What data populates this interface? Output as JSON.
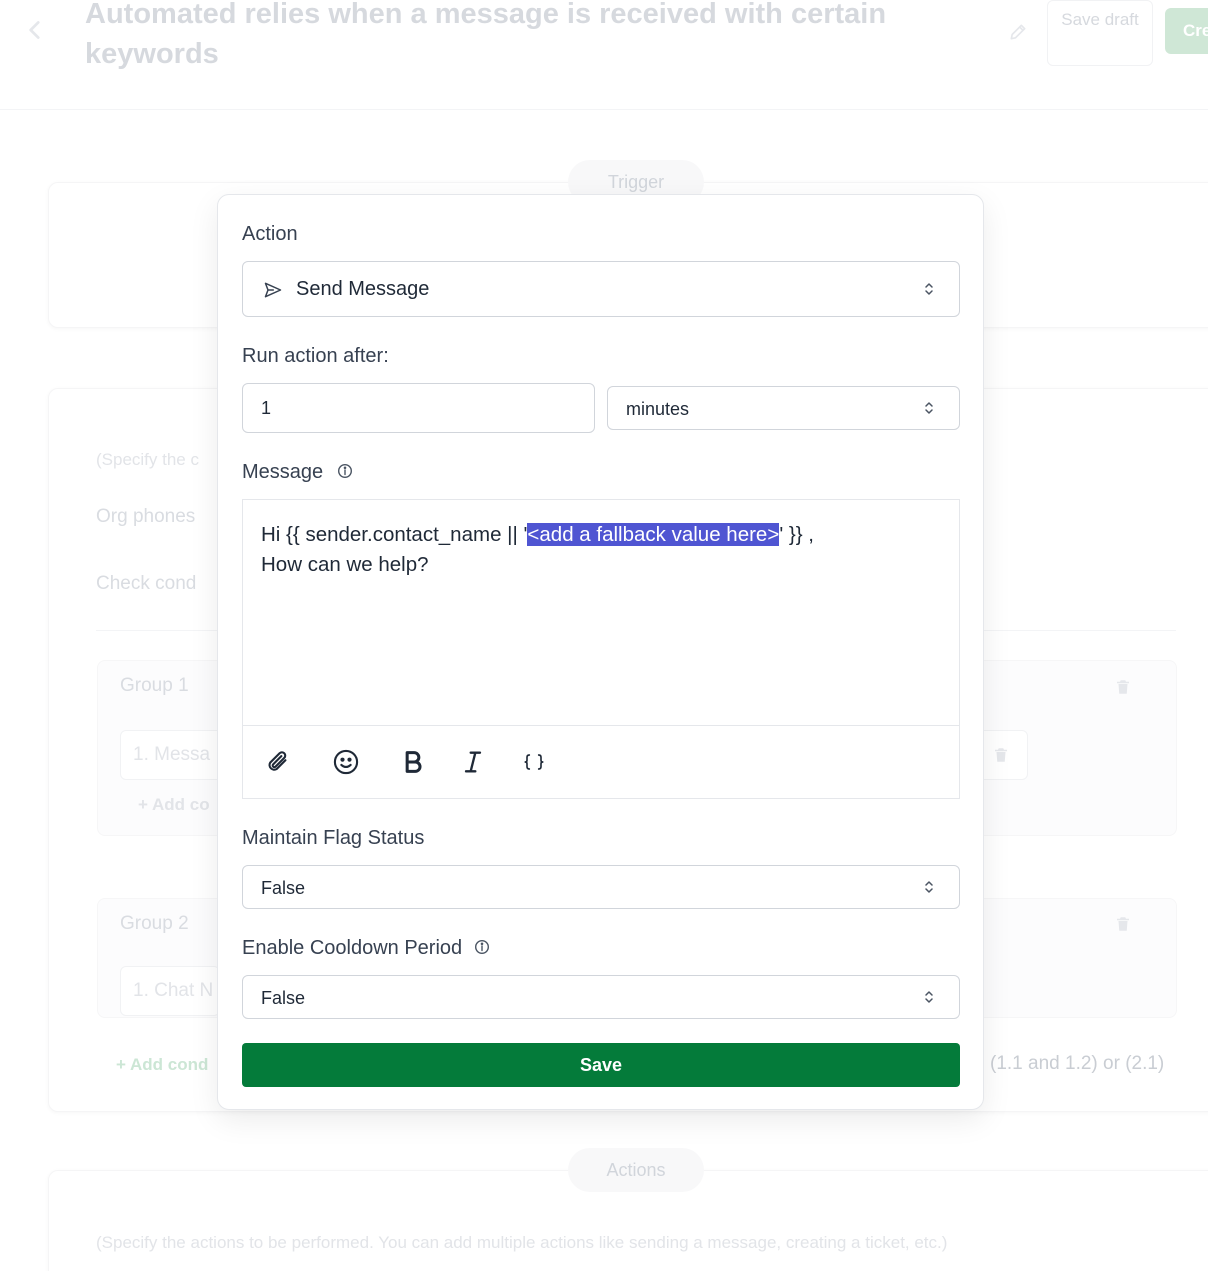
{
  "header": {
    "title": "Automated relies when a message is received with certain keywords",
    "save_draft_label": "Save draft",
    "create_label": "Cre"
  },
  "background": {
    "trigger_label": "Trigger",
    "conditions_hint": "(Specify the c",
    "org_phones_label": "Org phones",
    "check_conditions_label": "Check cond",
    "group1_title": "Group 1",
    "group1_condition": "1. Messa",
    "group1_add_condition": "+ Add co",
    "group2_title": "Group 2",
    "group2_condition": "1. Chat N",
    "add_condition_group": "+ Add cond",
    "condition_logic": "(1.1 and 1.2) or (2.1)",
    "actions_label": "Actions",
    "actions_hint": "(Specify the actions to be performed. You can add multiple actions like sending a message, creating a ticket, etc.)"
  },
  "modal": {
    "action_label": "Action",
    "action_value": "Send Message",
    "run_after_label": "Run action after:",
    "run_after_value": "1",
    "run_after_unit": "minutes",
    "message_label": "Message",
    "message_text_before": "Hi {{ sender.contact_name || '",
    "message_highlight": "<add a fallback value here>",
    "message_text_after": "' }} ,",
    "message_line2": "How can we help?",
    "flag_label": "Maintain Flag Status",
    "flag_value": "False",
    "cooldown_label": "Enable Cooldown Period",
    "cooldown_value": "False",
    "save_label": "Save"
  }
}
